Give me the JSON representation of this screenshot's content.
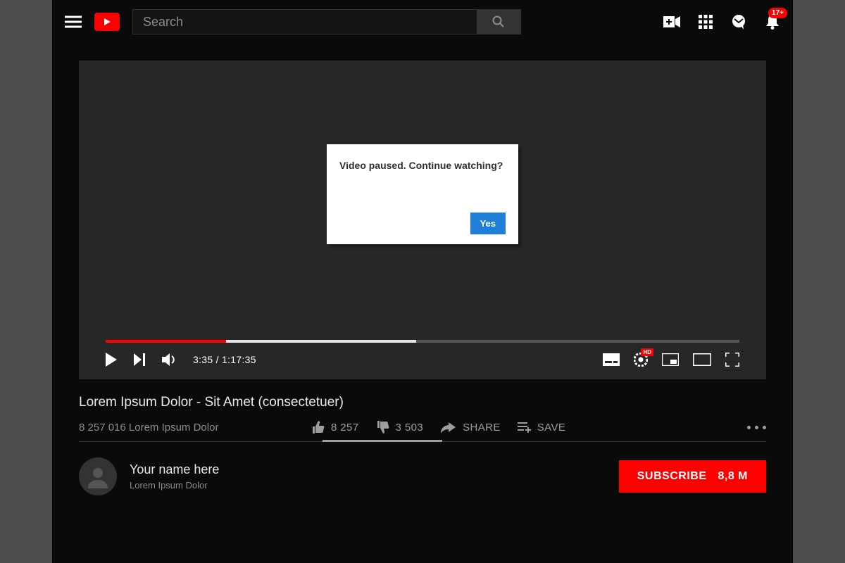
{
  "header": {
    "search_placeholder": "Search",
    "notification_badge": "17+"
  },
  "player": {
    "dialog_message": "Video paused. Continue watching?",
    "dialog_yes": "Yes",
    "current_time": "3:35",
    "duration": "1:17:35",
    "time_display": "3:35 / 1:17:35",
    "settings_hd_badge": "HD"
  },
  "video": {
    "title": "Lorem Ipsum Dolor - Sit Amet (consectetuer)",
    "views_line": "8 257 016 Lorem Ipsum Dolor",
    "likes": "8 257",
    "dislikes": "3 503",
    "share_label": "SHARE",
    "save_label": "SAVE"
  },
  "channel": {
    "name": "Your name here",
    "subtitle": "Lorem Ipsum Dolor",
    "subscribe_label": "SUBSCRIBE",
    "subscriber_count": "8,8 M"
  }
}
